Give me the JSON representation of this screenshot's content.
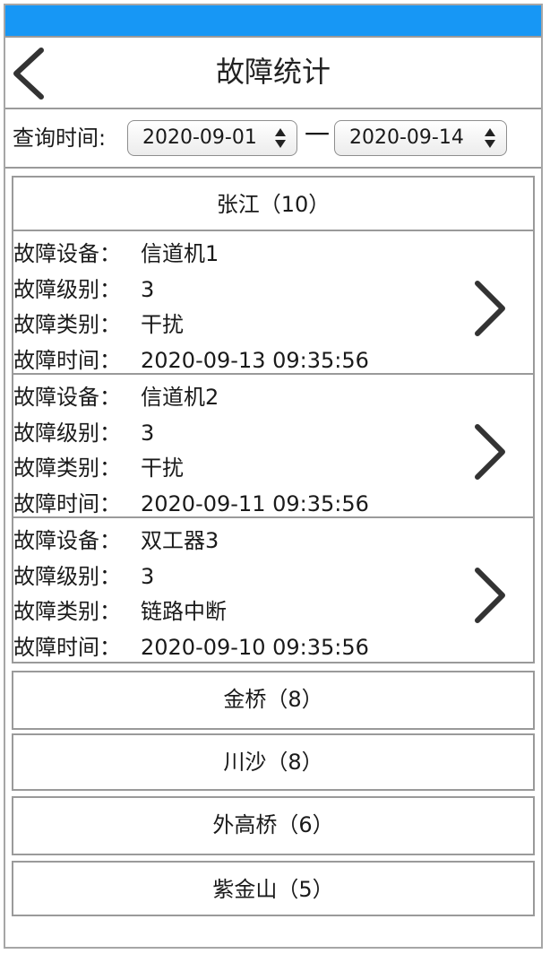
{
  "header": {
    "title": "故障统计"
  },
  "query": {
    "label": "查询时间:",
    "start_date": "2020-09-01",
    "separator": "一",
    "end_date": "2020-09-14"
  },
  "groups": [
    {
      "label": "张江（10）",
      "expanded": true,
      "faults": [
        {
          "device_label": "故障设备：",
          "device": "信道机1",
          "level_label": "故障级别：",
          "level": "3",
          "type_label": "故障类别：",
          "type": "干扰",
          "time_label": "故障时间：",
          "time": "2020-09-13 09:35:56"
        },
        {
          "device_label": "故障设备：",
          "device": "信道机2",
          "level_label": "故障级别：",
          "level": "3",
          "type_label": "故障类别：",
          "type": "干扰",
          "time_label": "故障时间：",
          "time": "2020-09-11 09:35:56"
        },
        {
          "device_label": "故障设备：",
          "device": "双工器3",
          "level_label": "故障级别：",
          "level": "3",
          "type_label": "故障类别：",
          "type": "链路中断",
          "time_label": "故障时间：",
          "time": "2020-09-10 09:35:56"
        }
      ]
    },
    {
      "label": "金桥（8）",
      "expanded": false
    },
    {
      "label": "川沙（8）",
      "expanded": false
    },
    {
      "label": "外高桥（6）",
      "expanded": false
    },
    {
      "label": "紫金山（5）",
      "expanded": false
    }
  ],
  "icons": {
    "back": "chevron-left-icon",
    "detail": "chevron-right-icon",
    "select": "select-arrows-icon"
  },
  "colors": {
    "status_bar": "#1797f5",
    "border": "#9a9a9a",
    "text": "#1a1a1a"
  }
}
